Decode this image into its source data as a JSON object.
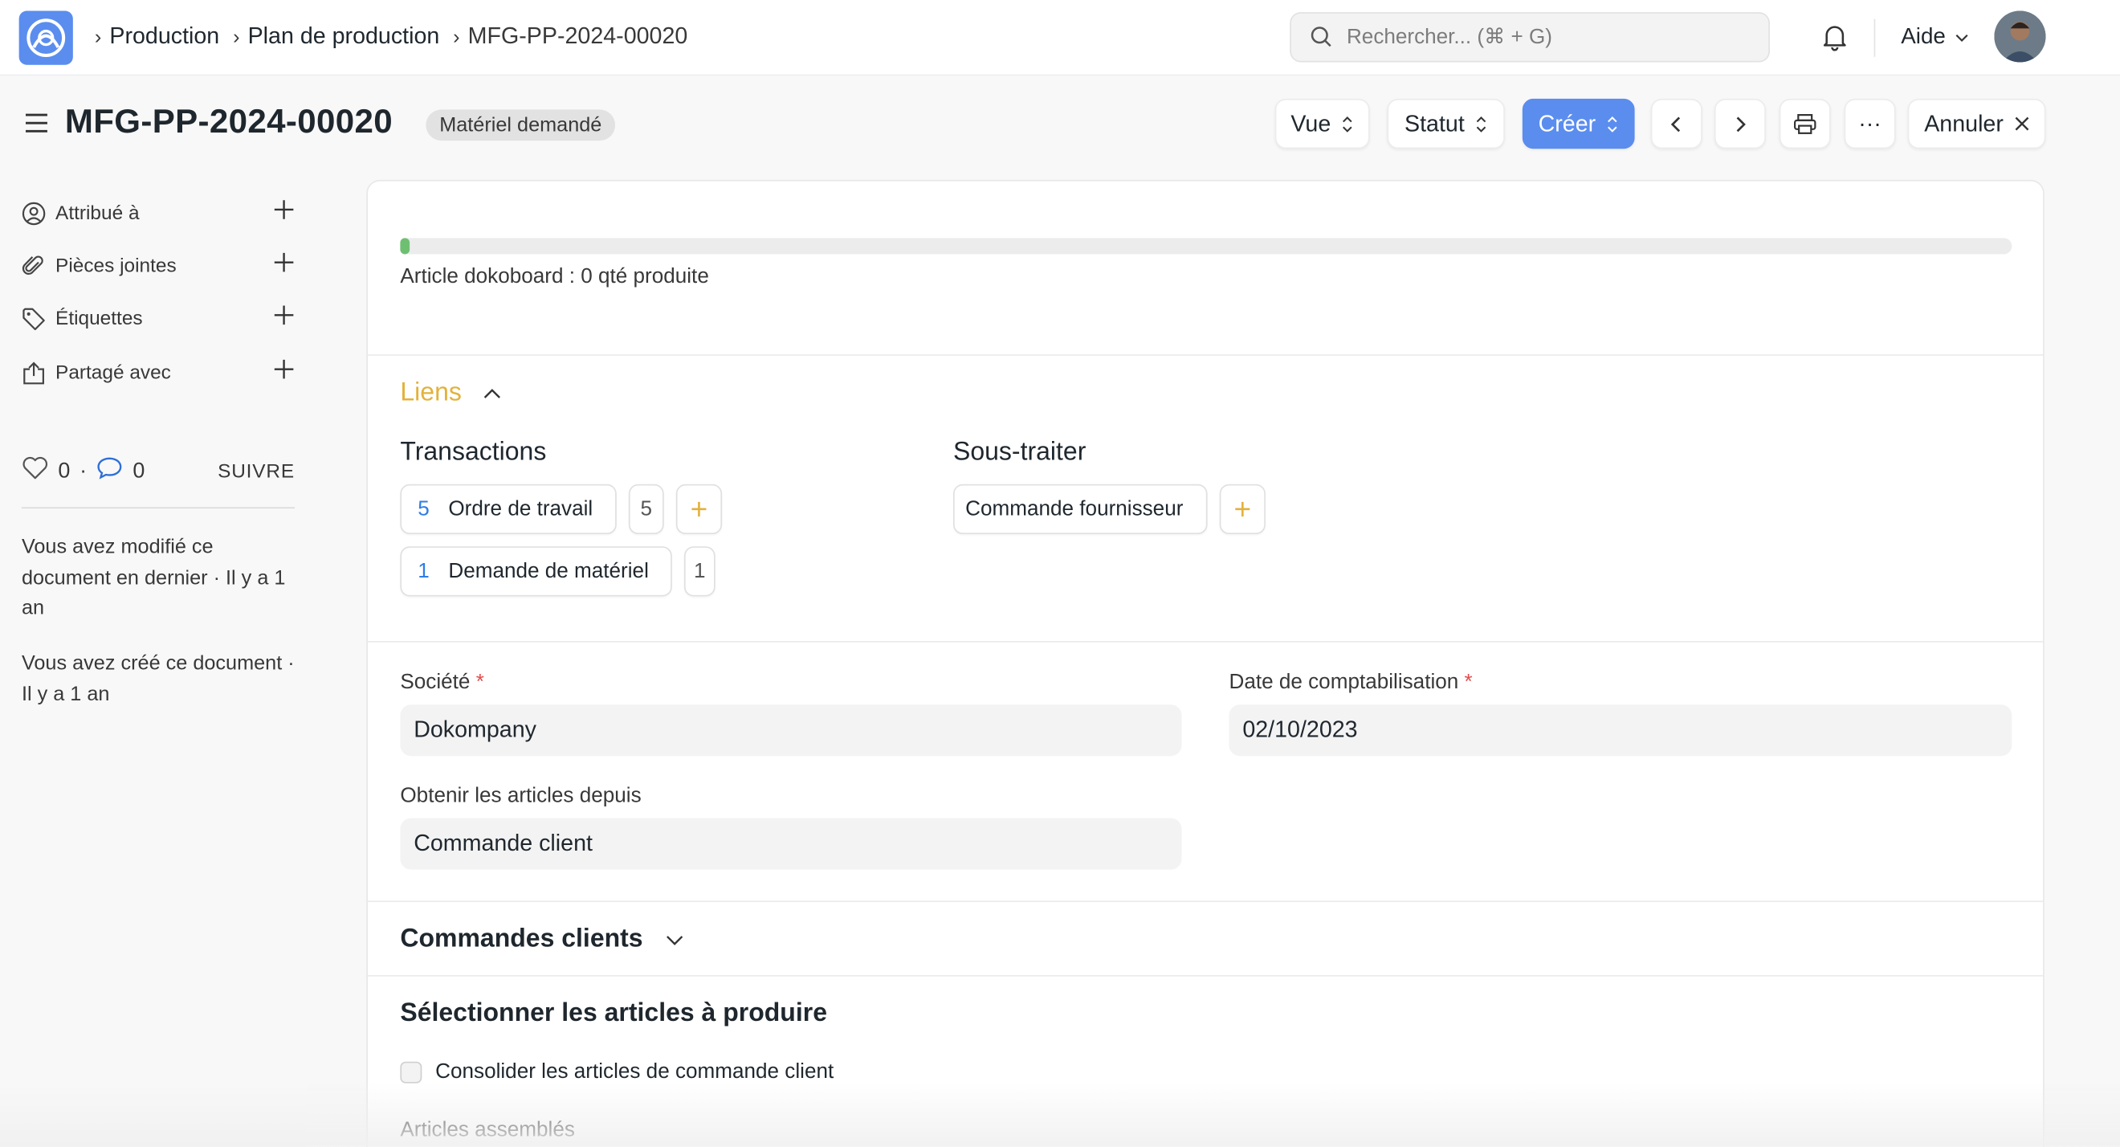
{
  "navbar": {
    "breadcrumbs": [
      "Production",
      "Plan de production",
      "MFG-PP-2024-00020"
    ],
    "search_placeholder": "Rechercher... (⌘ + G)",
    "help_label": "Aide"
  },
  "page": {
    "title": "MFG-PP-2024-00020",
    "status_badge": "Matériel demandé",
    "buttons": {
      "view": "Vue",
      "status": "Statut",
      "create": "Créer",
      "more": "···",
      "cancel": "Annuler"
    }
  },
  "sidebar": {
    "items": [
      {
        "label": "Attribué à",
        "icon": "assign-icon"
      },
      {
        "label": "Pièces jointes",
        "icon": "paperclip-icon"
      },
      {
        "label": "Étiquettes",
        "icon": "tag-icon"
      },
      {
        "label": "Partagé avec",
        "icon": "share-icon"
      }
    ],
    "likes": "0",
    "comments": "0",
    "follow_label": "SUIVRE",
    "activity": [
      "Vous avez modifié ce document en dernier · Il y a 1 an",
      "Vous avez créé ce document · Il y a 1 an"
    ]
  },
  "form": {
    "progress": {
      "fraction": 0.005,
      "label": "Article dokoboard : 0 qté produite"
    },
    "links": {
      "title": "Liens",
      "transactions_title": "Transactions",
      "subcontract_title": "Sous-traiter",
      "transactions": [
        {
          "count": "5",
          "label": "Ordre de travail",
          "badge": "5"
        },
        {
          "count": "1",
          "label": "Demande de matériel",
          "badge": "1"
        }
      ],
      "subcontract": [
        {
          "label": "Commande fournisseur"
        }
      ]
    },
    "company_label": "Société",
    "company_value": "Dokompany",
    "posting_date_label": "Date de comptabilisation",
    "posting_date_value": "02/10/2023",
    "get_items_from_label": "Obtenir les articles depuis",
    "get_items_from_value": "Commande client",
    "sales_orders_title": "Commandes clients",
    "select_items_title": "Sélectionner les articles à produire",
    "consolidate_label": "Consolider les articles de commande client",
    "assembly_items_label": "Articles assemblés"
  },
  "colors": {
    "primary": "#5b8def",
    "accent": "#e3b23c",
    "progress": "#6fbf73",
    "required": "#e24c4c",
    "link_count": "#2e7de6"
  }
}
